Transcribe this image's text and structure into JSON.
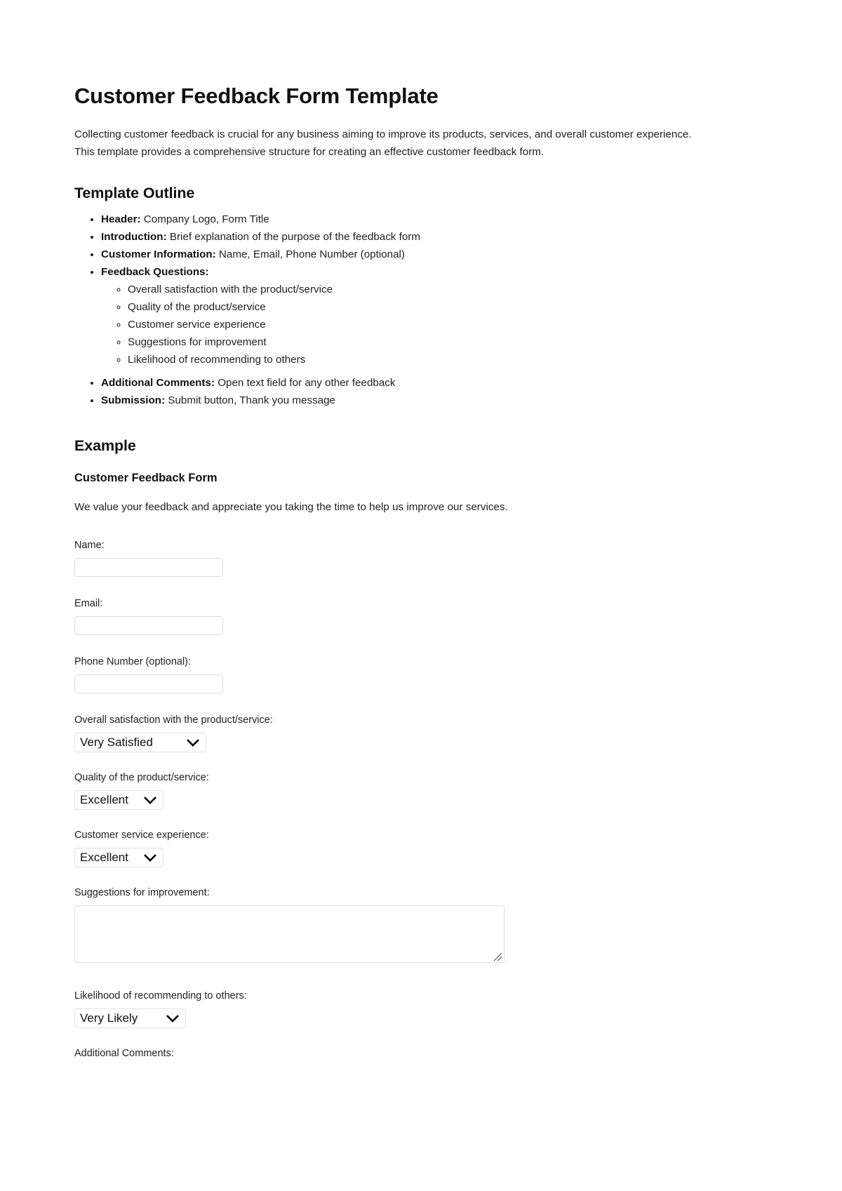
{
  "document": {
    "title": "Customer Feedback Form Template",
    "intro": "Collecting customer feedback is crucial for any business aiming to improve its products, services, and overall customer experience. This template provides a comprehensive structure for creating an effective customer feedback form."
  },
  "outline": {
    "heading": "Template Outline",
    "items": [
      {
        "label": "Header:",
        "text": " Company Logo, Form Title"
      },
      {
        "label": "Introduction:",
        "text": " Brief explanation of the purpose of the feedback form"
      },
      {
        "label": "Customer Information:",
        "text": " Name, Email, Phone Number (optional)"
      },
      {
        "label": "Feedback Questions:",
        "text": ""
      },
      {
        "label": "Additional Comments:",
        "text": " Open text field for any other feedback"
      },
      {
        "label": "Submission:",
        "text": " Submit button, Thank you message"
      }
    ],
    "feedback_questions": [
      "Overall satisfaction with the product/service",
      "Quality of the product/service",
      "Customer service experience",
      "Suggestions for improvement",
      "Likelihood of recommending to others"
    ]
  },
  "example": {
    "heading": "Example",
    "form_title": "Customer Feedback Form",
    "form_subtitle": "We value your feedback and appreciate you taking the time to help us improve our services.",
    "fields": {
      "name": {
        "label": "Name:",
        "value": "",
        "placeholder": ""
      },
      "email": {
        "label": "Email:",
        "value": "",
        "placeholder": ""
      },
      "phone": {
        "label": "Phone Number (optional):",
        "value": "",
        "placeholder": ""
      },
      "satisfaction": {
        "label": "Overall satisfaction with the product/service:",
        "selected": "Very Satisfied",
        "icon": "chevron-down-icon"
      },
      "quality": {
        "label": "Quality of the product/service:",
        "selected": "Excellent",
        "icon": "chevron-down-icon"
      },
      "service": {
        "label": "Customer service experience:",
        "selected": "Excellent",
        "icon": "chevron-down-icon"
      },
      "suggestions": {
        "label": "Suggestions for improvement:",
        "value": "",
        "placeholder": "",
        "icon": "resize-grip-icon"
      },
      "likelihood": {
        "label": "Likelihood of recommending to others:",
        "selected": "Very Likely",
        "icon": "chevron-down-icon"
      },
      "additional_comments": {
        "label": "Additional Comments:"
      }
    }
  },
  "colors": {
    "page_background": "#ffffff",
    "text": "#1f1f1f",
    "heading": "#111111",
    "input_border": "#dcdcdc",
    "select_border": "#e2e2e2"
  }
}
